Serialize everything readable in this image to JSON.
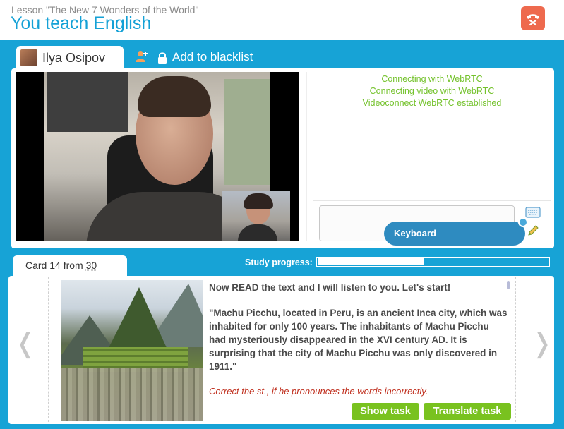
{
  "header": {
    "lesson_title": "Lesson \"The New 7 Wonders of the World\"",
    "page_title": "You teach English",
    "end_call_icon": "phone-hangup-icon",
    "end_call_color": "#ee6a4e"
  },
  "user": {
    "name": "Ilya Osipov",
    "add_contact_icon": "add-contact-icon",
    "blacklist_icon": "lock-icon",
    "blacklist_label": "Add to blacklist"
  },
  "connection_log": [
    "Connecting with WebRTC",
    "Connecting video with WebRTC",
    "Videoconnect WebRTC established"
  ],
  "chat": {
    "input_value": "",
    "keyboard_tip": "Keyboard",
    "keyboard_icon": "keyboard-icon",
    "pencil_icon": "pencil-icon"
  },
  "card": {
    "prefix": "Card 14 from",
    "total": "30",
    "progress_label": "Study progress:",
    "progress_fraction": 0.46,
    "image_subject": "Machu Picchu",
    "instruction": "Now READ the text and I will listen to you. Let's start!",
    "passage": "\"Machu Picchu, located in Peru, is an ancient Inca city, which was inhabited for only 100 years. The inhabitants of Machu Picchu had mysteriously disappeared in the XVI century AD. It is surprising that the city of Machu Picchu was only discovered in 1911.\"",
    "teacher_note": "Correct the st., if he pronounces the words incorrectly.",
    "prev_arrow": "❬",
    "next_arrow": "❭",
    "show_task_label": "Show task",
    "translate_task_label": "Translate task"
  },
  "colors": {
    "brand_blue": "#17a3d6",
    "title_blue": "#14a1d6",
    "status_green": "#74c22c",
    "button_green": "#79c21f",
    "note_red": "#c0301f"
  }
}
